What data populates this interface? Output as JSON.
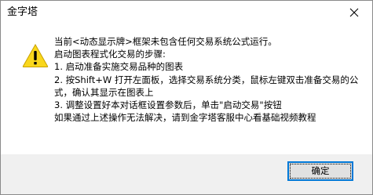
{
  "window": {
    "title": "金字塔"
  },
  "icons": {
    "warning": "warning-triangle-icon",
    "close": "close-x-icon",
    "warning_color": "#f9d71c"
  },
  "message": {
    "lines": [
      "当前<动态显示牌>框架未包含任何交易系统公式运行。",
      "启动图表程式化交易的步骤:",
      "1. 启动准备实施交易品种的图表",
      "2. 按Shift+W 打开左面板，选择交易系统分类，鼠标左键双击准备交易的公式，确认其显示在图表上",
      "3. 调整设置好本对话框设置参数后，单击\"启动交易\"按钮",
      "如果通过上述操作无法解决，请到金字塔客服中心看基础视频教程"
    ]
  },
  "buttons": {
    "ok_label": "确定"
  }
}
